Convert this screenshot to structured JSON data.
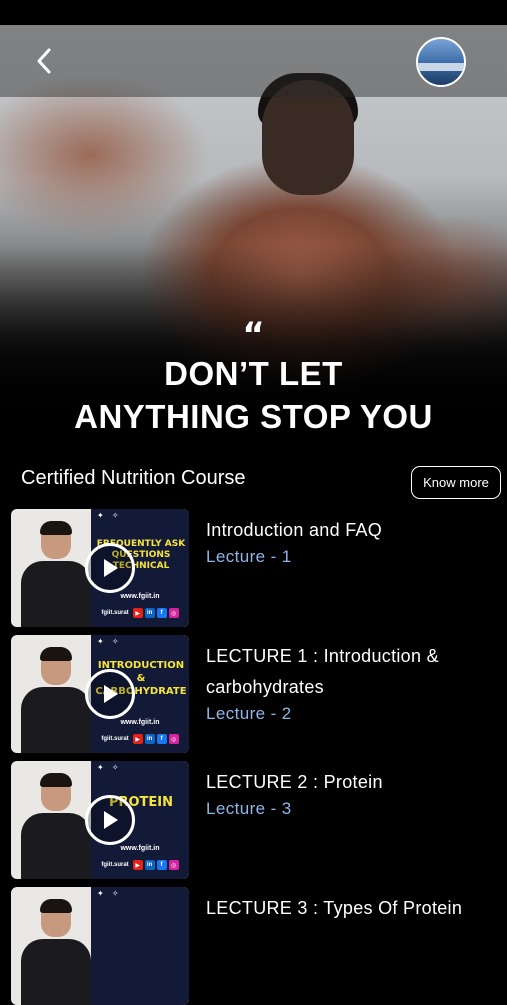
{
  "header": {
    "back_icon": "chevron-left-icon",
    "avatar_icon": "profile-avatar"
  },
  "hero": {
    "quote_mark": "“",
    "slogan_line1": "DON’T LET",
    "slogan_line2": "ANYTHING STOP YOU"
  },
  "course": {
    "title": "Certified Nutrition Course",
    "know_more_label": "Know more"
  },
  "lectures": [
    {
      "title_line1": "Introduction and FAQ",
      "title_line2": "",
      "subtitle": "Lecture - 1",
      "thumb_text": [
        "FREQUENTLY ASK",
        "QUESTIONS",
        "TECHNICAL"
      ],
      "thumb_url": "www.fgiit.in",
      "thumb_handle": "fgiit.surat"
    },
    {
      "title_line1": "LECTURE 1 :  Introduction &",
      "title_line2": "carbohydrates",
      "subtitle": "Lecture - 2",
      "thumb_text": [
        "INTRODUCTION",
        "&",
        "CARBOHYDRATE"
      ],
      "thumb_url": "www.fgiit.in",
      "thumb_handle": "fgiit.surat"
    },
    {
      "title_line1": "LECTURE 2 : Protein",
      "title_line2": "",
      "subtitle": "Lecture - 3",
      "thumb_text": [
        "PROTEIN"
      ],
      "thumb_url": "www.fgiit.in",
      "thumb_handle": "fgiit.surat"
    },
    {
      "title_line1": "LECTURE 3 : Types Of Protein",
      "title_line2": "",
      "subtitle": "",
      "thumb_text": [],
      "thumb_url": "",
      "thumb_handle": ""
    }
  ],
  "colors": {
    "background": "#000000",
    "subtitle_blue": "#8eb4e8",
    "thumb_panel": "#121a38",
    "thumb_text_yellow": "#f7e43a"
  }
}
